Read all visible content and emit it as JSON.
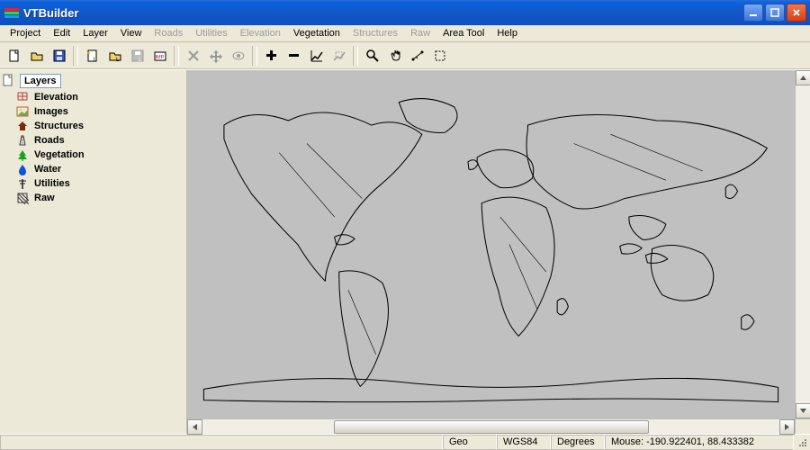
{
  "window": {
    "title": "VTBuilder"
  },
  "menu": {
    "items": [
      {
        "label": "Project",
        "enabled": true
      },
      {
        "label": "Edit",
        "enabled": true
      },
      {
        "label": "Layer",
        "enabled": true
      },
      {
        "label": "View",
        "enabled": true
      },
      {
        "label": "Roads",
        "enabled": false
      },
      {
        "label": "Utilities",
        "enabled": false
      },
      {
        "label": "Elevation",
        "enabled": false
      },
      {
        "label": "Vegetation",
        "enabled": true
      },
      {
        "label": "Structures",
        "enabled": false
      },
      {
        "label": "Raw",
        "enabled": false
      },
      {
        "label": "Area Tool",
        "enabled": true
      },
      {
        "label": "Help",
        "enabled": true
      }
    ]
  },
  "toolbar": {
    "groups": [
      [
        "new",
        "open",
        "save"
      ],
      [
        "new-layer",
        "open-layer",
        "save-layer",
        "import"
      ],
      [
        "delete",
        "show-extents",
        "visible"
      ],
      [
        "zoom-in",
        "zoom-out",
        "zoom-all",
        "zoom-selection"
      ],
      [
        "magnifier",
        "pan",
        "distance",
        "area"
      ]
    ]
  },
  "layers_panel": {
    "header": "Layers",
    "items": [
      {
        "label": "Elevation",
        "icon": "grid",
        "color": "#b44040"
      },
      {
        "label": "Images",
        "icon": "image",
        "color": "#bb6317"
      },
      {
        "label": "Structures",
        "icon": "house",
        "color": "#7b2a0c"
      },
      {
        "label": "Roads",
        "icon": "road",
        "color": "#353535"
      },
      {
        "label": "Vegetation",
        "icon": "tree",
        "color": "#1e9c1e"
      },
      {
        "label": "Water",
        "icon": "drop",
        "color": "#1250e0"
      },
      {
        "label": "Utilities",
        "icon": "pole",
        "color": "#222"
      },
      {
        "label": "Raw",
        "icon": "hatch",
        "color": "#333"
      }
    ]
  },
  "status": {
    "projection": "Geo",
    "datum": "WGS84",
    "units": "Degrees",
    "mouse": "Mouse: -190.922401, 88.433382"
  }
}
